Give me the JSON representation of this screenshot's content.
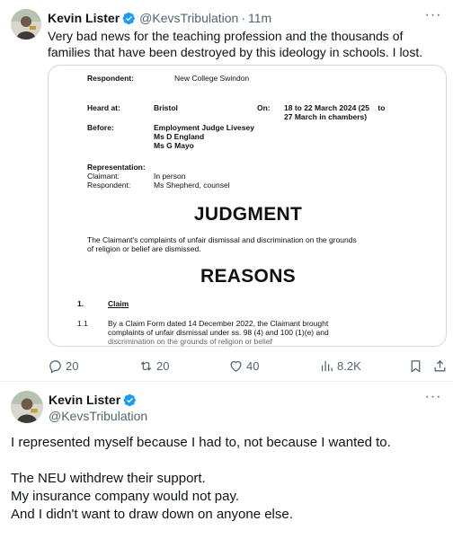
{
  "tweet1": {
    "author_name": "Kevin Lister",
    "handle": "@KevsTribulation",
    "separator": "·",
    "time": "11m",
    "text": "Very bad news for the teaching profession and the thousands of families that have been destroyed by this ideology in schools. I lost.",
    "document": {
      "respondent_label": "Respondent:",
      "respondent_value": "New College Swindon",
      "heard_at_label": "Heard at:",
      "heard_at_value": "Bristol",
      "on_label": "On:",
      "on_value_line1": "18 to 22 March 2024 (25    to",
      "on_value_line2": "27 March in chambers)",
      "before_label": "Before:",
      "before_judge": "Employment Judge Livesey",
      "before_member1": "Ms D England",
      "before_member2": "Ms G Mayo",
      "representation_label": "Representation:",
      "claimant_label": "Claimant:",
      "claimant_value": "In person",
      "respondent2_label": "Respondent:",
      "respondent2_value": "Ms Shepherd, counsel",
      "judgment_heading": "JUDGMENT",
      "judgment_line1": "The Claimant's complaints of unfair dismissal and discrimination on the grounds",
      "judgment_line2": "of religion or belief are dismissed.",
      "reasons_heading": "REASONS",
      "section_number": "1.",
      "section_title": "Claim",
      "para_number": "1.1",
      "para_line1": "By a Claim Form dated 14 December 2022, the Claimant brought",
      "para_line2": "complaints of unfair dismissal under ss. 98 (4) and 100 (1)(e) and",
      "para_line3": "discrimination on the grounds of religion or belief"
    },
    "actions": {
      "replies": "20",
      "reposts": "20",
      "likes": "40",
      "views": "8.2K"
    }
  },
  "tweet2": {
    "author_name": "Kevin Lister",
    "handle": "@KevsTribulation",
    "line1": "I represented myself because I had to, not because I wanted to.",
    "line2": "The NEU withdrew their support.",
    "line3": "My insurance company would not pay.",
    "line4": "And I didn't want to draw down on anyone else."
  },
  "colors": {
    "text_primary": "#0f1419",
    "text_secondary": "#536471",
    "verified_blue": "#1d9bf0",
    "border": "#cfd9de"
  },
  "icons": {
    "verified": "verified-badge-icon",
    "more": "more-options-icon",
    "reply": "reply-icon",
    "repost": "repost-icon",
    "like": "heart-icon",
    "views": "views-chart-icon",
    "bookmark": "bookmark-icon",
    "share": "share-icon"
  }
}
